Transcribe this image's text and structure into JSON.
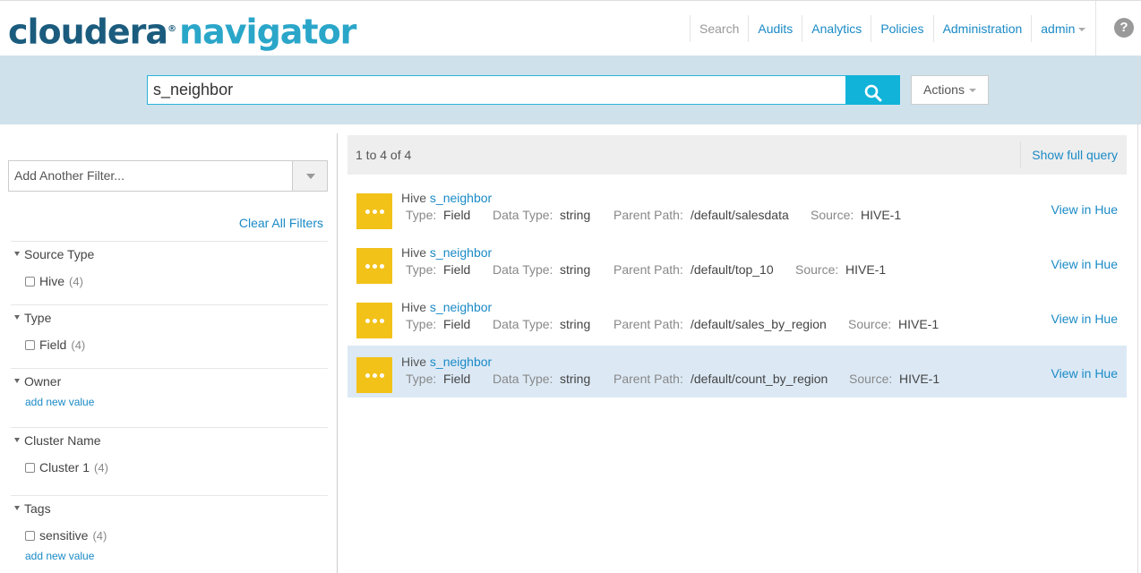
{
  "header": {
    "logo_brand": "cloudera",
    "logo_reg": "®",
    "logo_product": "navigator",
    "nav": [
      {
        "label": "Search",
        "muted": true
      },
      {
        "label": "Audits",
        "muted": false
      },
      {
        "label": "Analytics",
        "muted": false
      },
      {
        "label": "Policies",
        "muted": false
      },
      {
        "label": "Administration",
        "muted": false
      },
      {
        "label": "admin",
        "muted": false
      }
    ],
    "help_glyph": "?"
  },
  "search": {
    "query": "s_neighbor",
    "actions_label": "Actions"
  },
  "sidebar": {
    "add_filter_label": "Add Another Filter...",
    "clear_filters": "Clear All Filters",
    "facets": [
      {
        "title": "Source Type",
        "options": [
          {
            "label": "Hive",
            "count": "(4)"
          }
        ],
        "link": ""
      },
      {
        "title": "Type",
        "options": [
          {
            "label": "Field",
            "count": "(4)"
          }
        ],
        "link": ""
      },
      {
        "title": "Owner",
        "options": [],
        "link": "add new value"
      },
      {
        "title": "Cluster Name",
        "options": [
          {
            "label": "Cluster 1",
            "count": "(4)"
          }
        ],
        "link": ""
      },
      {
        "title": "Tags",
        "options": [
          {
            "label": "sensitive",
            "count": "(4)"
          }
        ],
        "link": "add new value"
      }
    ]
  },
  "results": {
    "count_text": "1 to 4 of 4",
    "show_query": "Show full query",
    "labels": {
      "type": "Type:",
      "data_type": "Data Type:",
      "parent_path": "Parent Path:",
      "source": "Source:"
    },
    "view_label": "View in Hue",
    "items": [
      {
        "source_type": "Hive",
        "name": "s_neighbor",
        "type": "Field",
        "data_type": "string",
        "parent_path": "/default/salesdata",
        "source": "HIVE-1",
        "selected": false
      },
      {
        "source_type": "Hive",
        "name": "s_neighbor",
        "type": "Field",
        "data_type": "string",
        "parent_path": "/default/top_10",
        "source": "HIVE-1",
        "selected": false
      },
      {
        "source_type": "Hive",
        "name": "s_neighbor",
        "type": "Field",
        "data_type": "string",
        "parent_path": "/default/sales_by_region",
        "source": "HIVE-1",
        "selected": false
      },
      {
        "source_type": "Hive",
        "name": "s_neighbor",
        "type": "Field",
        "data_type": "string",
        "parent_path": "/default/count_by_region",
        "source": "HIVE-1",
        "selected": true
      }
    ]
  },
  "colors": {
    "accent": "#1a8ac6",
    "search_button": "#12b3d9",
    "search_band": "#cfe2ec",
    "result_icon": "#f2c219",
    "selected_row": "#dce9f5"
  },
  "icons": {
    "search_button": "search-icon",
    "result_item": "more-dots-icon",
    "help": "help-circle-icon"
  }
}
